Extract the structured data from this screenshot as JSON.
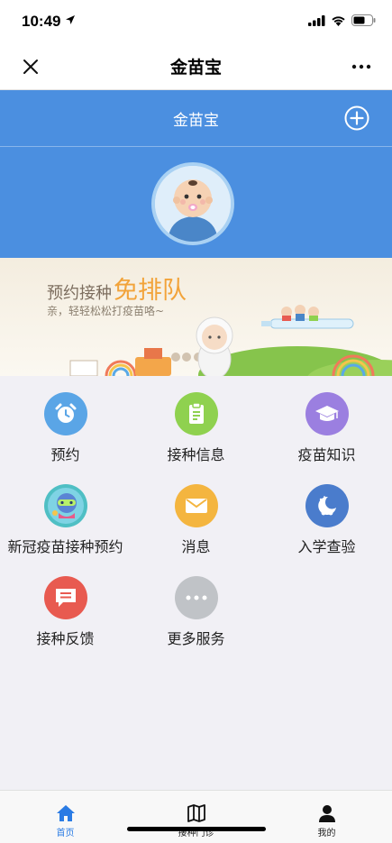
{
  "status_bar": {
    "time": "10:49"
  },
  "nav": {
    "title": "金苗宝"
  },
  "header": {
    "title": "金苗宝"
  },
  "banner": {
    "title": "预约接种",
    "title_highlight": "免排队",
    "subtitle": "亲，轻轻松松打疫苗咯~"
  },
  "grid": {
    "items": [
      {
        "label": "预约",
        "icon": "alarm-clock-icon",
        "color": "#5aa5e6"
      },
      {
        "label": "接种信息",
        "icon": "clipboard-icon",
        "color": "#8fd14f"
      },
      {
        "label": "疫苗知识",
        "icon": "graduation-cap-icon",
        "color": "#9b7fe0"
      },
      {
        "label": "新冠疫苗接种预约",
        "icon": "mascot-icon",
        "color": "#4fbfc4"
      },
      {
        "label": "消息",
        "icon": "envelope-icon",
        "color": "#f4b53f"
      },
      {
        "label": "入学查验",
        "icon": "baby-icon",
        "color": "#4a7ccc"
      },
      {
        "label": "接种反馈",
        "icon": "chat-bubble-icon",
        "color": "#e85a50"
      },
      {
        "label": "更多服务",
        "icon": "more-dots-icon",
        "color": "#c0c3c7"
      }
    ]
  },
  "tabs": [
    {
      "label": "首页",
      "icon": "home-icon",
      "active": true
    },
    {
      "label": "接种门诊",
      "icon": "map-icon",
      "active": false
    },
    {
      "label": "我的",
      "icon": "user-icon",
      "active": false
    }
  ],
  "colors": {
    "header_blue": "#4b8fe0",
    "tab_active": "#2a7be4"
  }
}
